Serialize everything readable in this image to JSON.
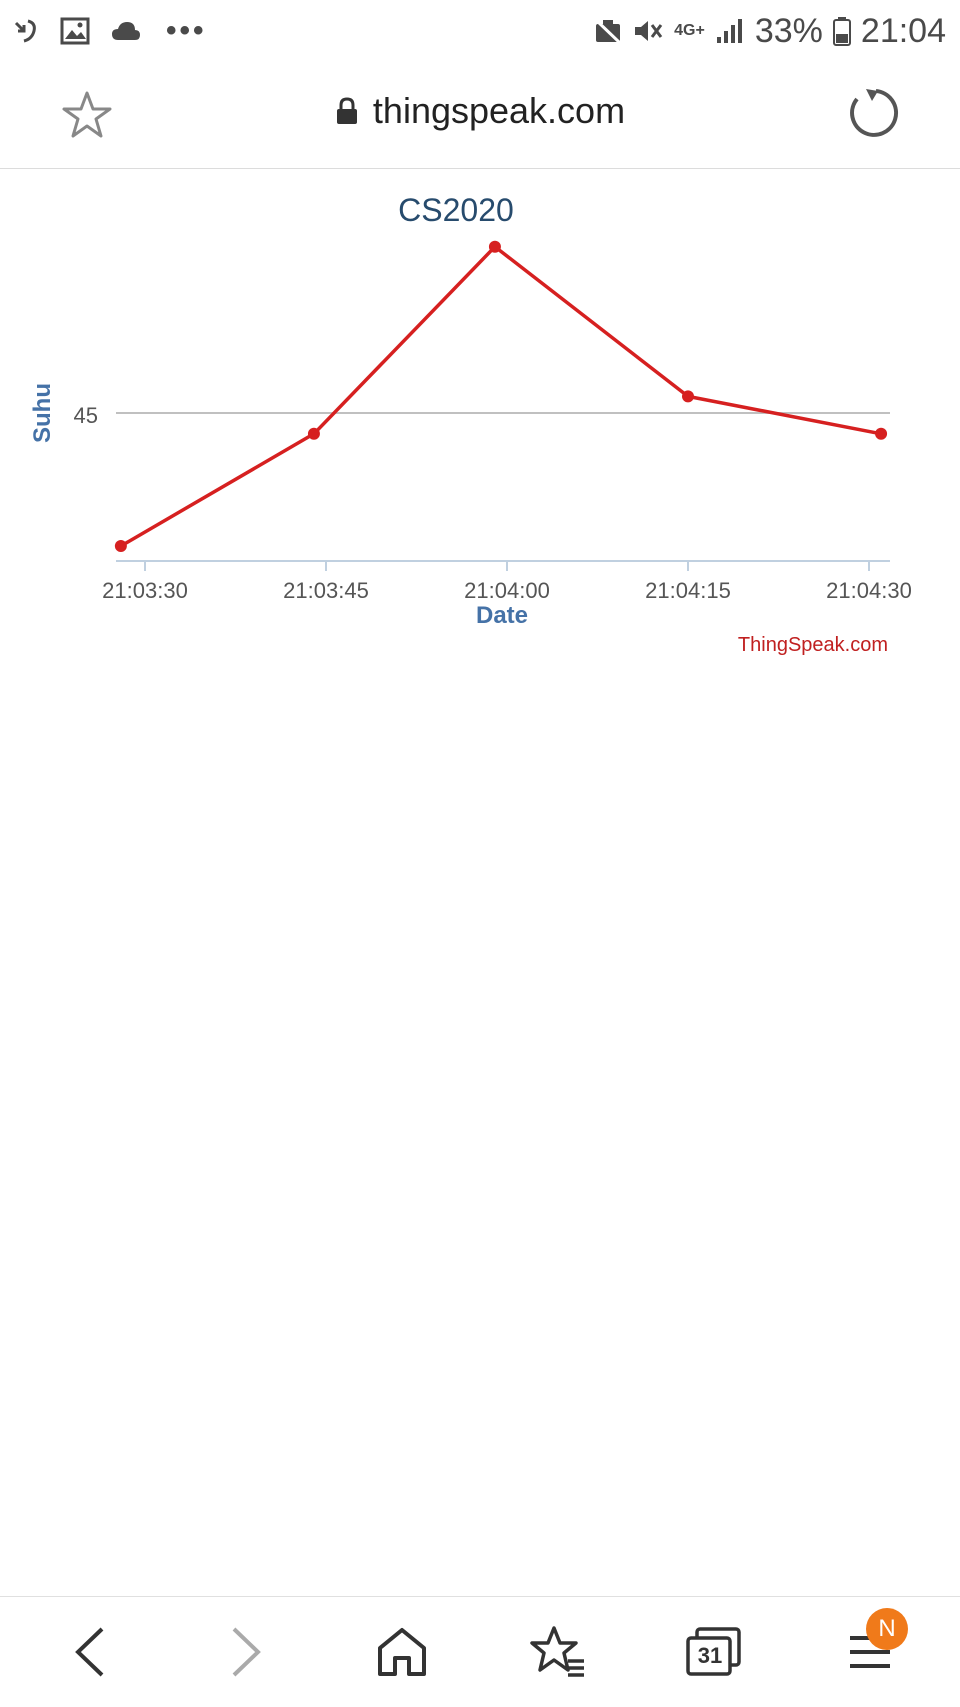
{
  "status_bar": {
    "icons_left": [
      "missed-call-icon",
      "image-icon",
      "cloud-icon"
    ],
    "more_dots": "•••",
    "network_label": "4G+",
    "battery_percent": "33%",
    "time": "21:04"
  },
  "browser": {
    "url": "thingspeak.com",
    "tabs_count": "31",
    "menu_badge": "N"
  },
  "chart_data": {
    "type": "line",
    "title": "CS2020",
    "xlabel": "Date",
    "ylabel": "Suhu",
    "x_tick_labels": [
      "21:03:30",
      "21:03:45",
      "21:04:00",
      "21:04:15",
      "21:04:30"
    ],
    "y_tick_labels": [
      "45"
    ],
    "credit": "ThingSpeak.com",
    "series": [
      {
        "color": "#d62020",
        "points": [
          {
            "x": "21:03:28",
            "y": 41.0
          },
          {
            "x": "21:03:44",
            "y": 44.0
          },
          {
            "x": "21:03:59",
            "y": 49.0
          },
          {
            "x": "21:04:15",
            "y": 45.0
          },
          {
            "x": "21:04:31",
            "y": 44.0
          }
        ]
      }
    ],
    "ylim": [
      40.6,
      49.5
    ],
    "grid": true
  },
  "colors": {
    "series": "#d62020",
    "title": "#274b6d",
    "axis_title": "#4572a7",
    "credit": "#c02020"
  }
}
